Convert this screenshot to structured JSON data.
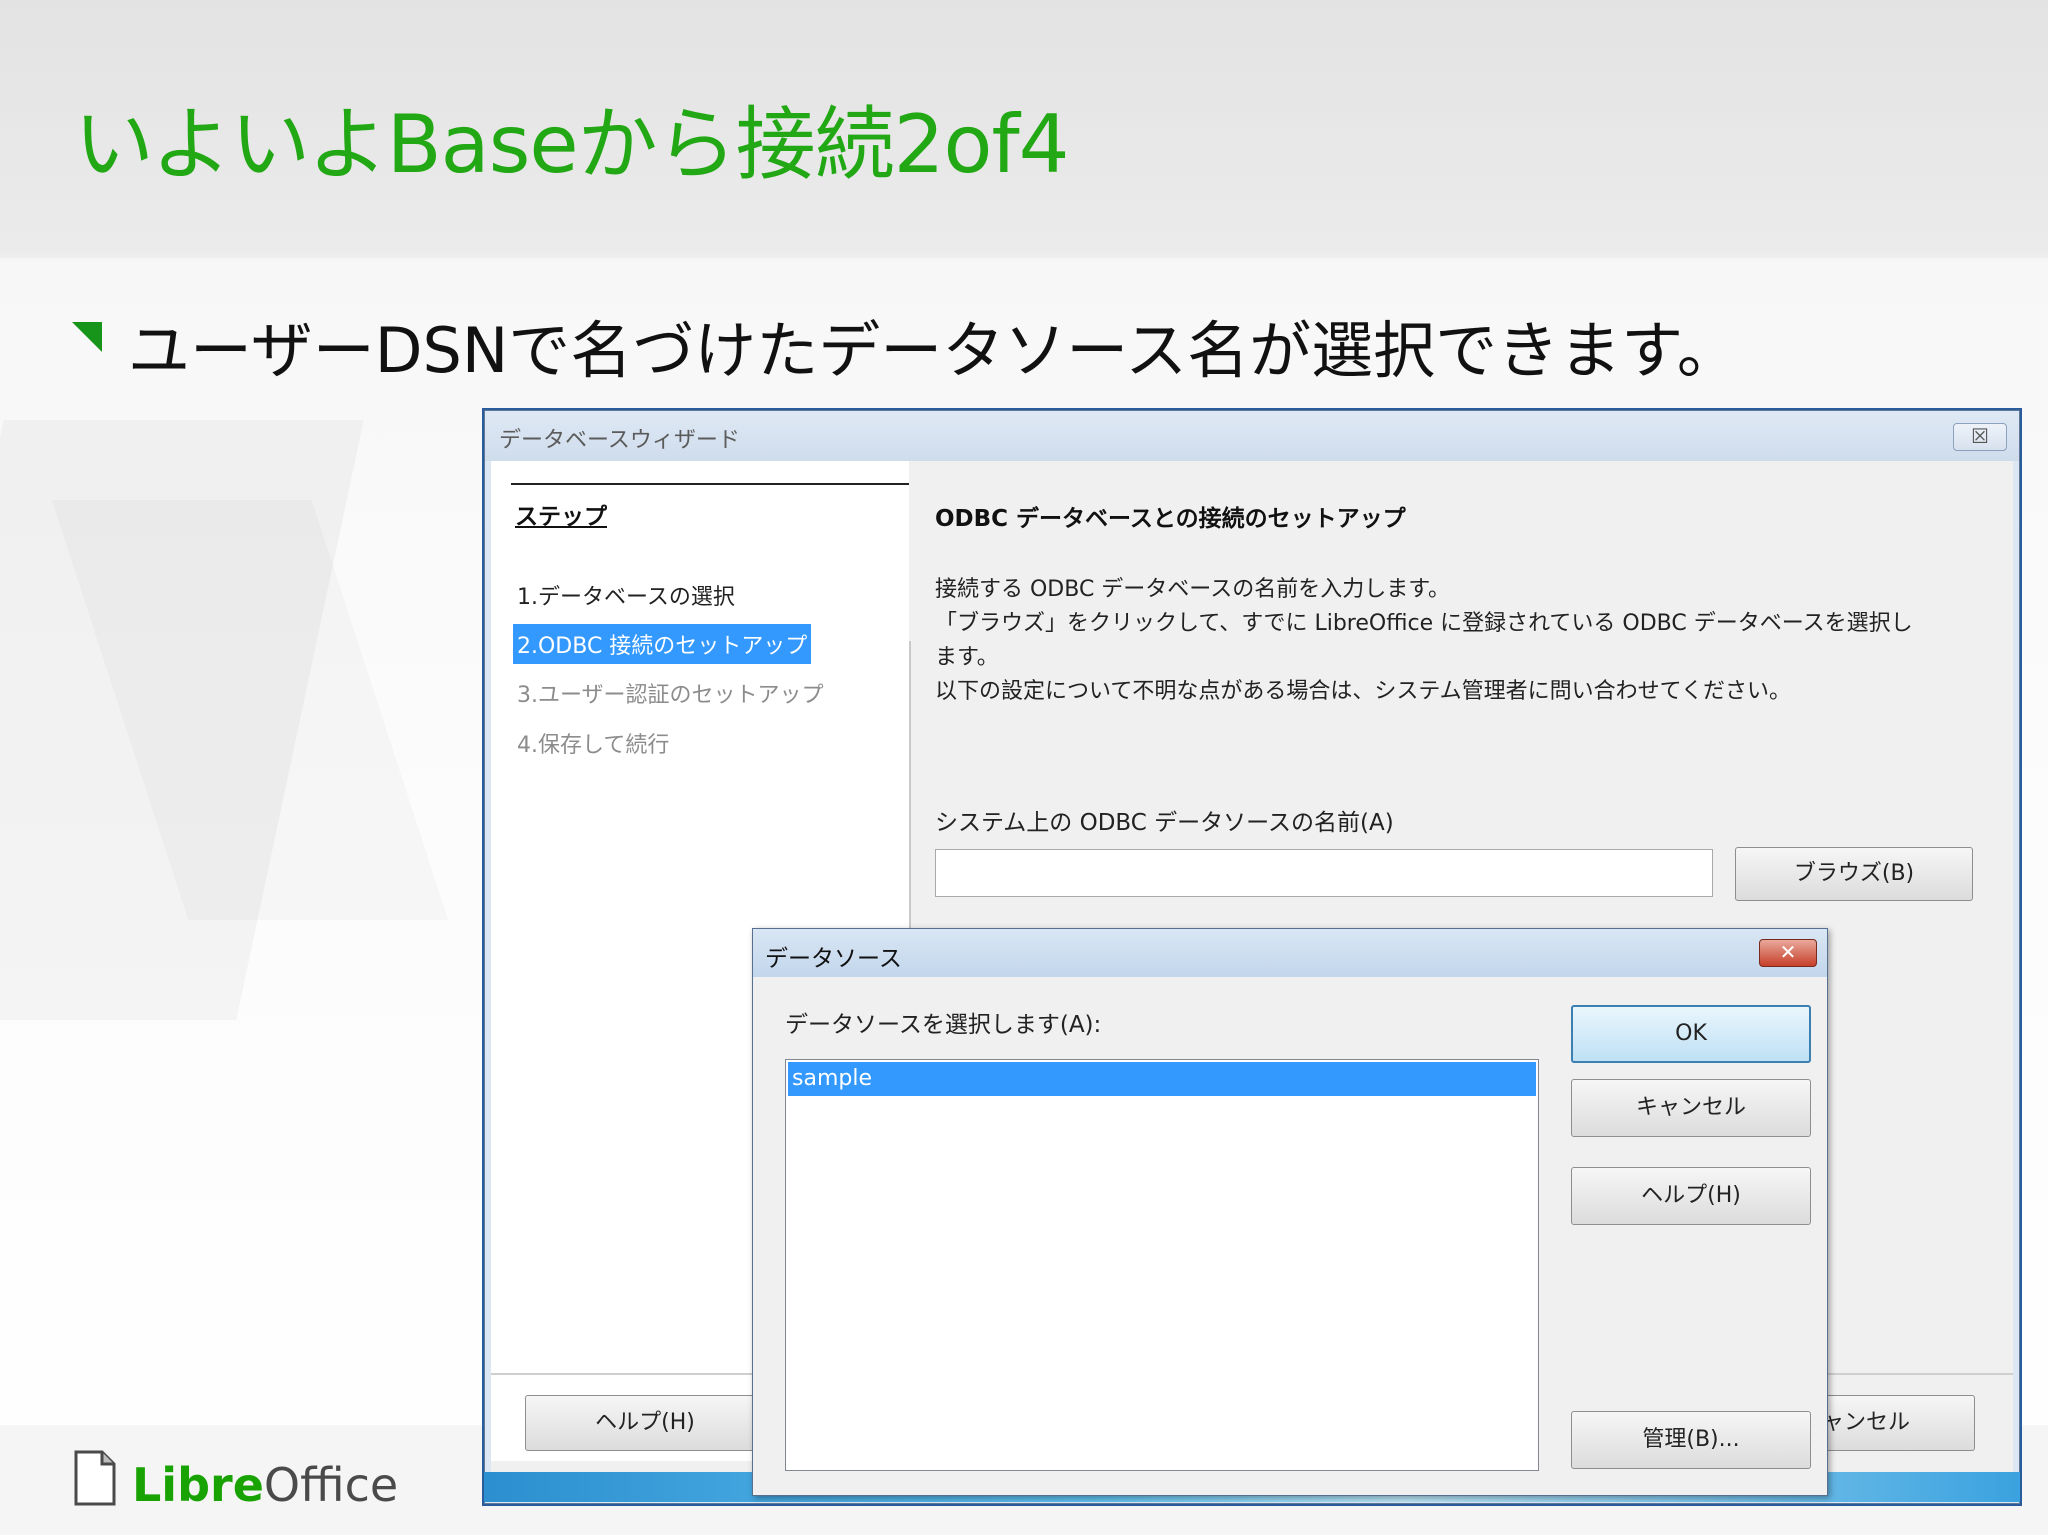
{
  "slide": {
    "title": "いよいよBaseから接続2of4",
    "bullet": "ユーザーDSNで名づけたデータソース名が選択できます。",
    "logo": {
      "libre": "Libre",
      "office": "Office"
    }
  },
  "wizard": {
    "title": "データベースウィザード",
    "close_label": "☒",
    "steps_heading": "ステップ",
    "steps": [
      "1.データベースの選択",
      "2.ODBC 接続のセットアップ",
      "3.ユーザー認証のセットアップ",
      "4.保存して続行"
    ],
    "page_heading": "ODBC データベースとの接続のセットアップ",
    "description_lines": [
      "接続する ODBC データベースの名前を入力します。",
      "「ブラウズ」をクリックして、すでに LibreOffice に登録されている ODBC データベースを選択し",
      "ます。",
      "以下の設定について不明な点がある場合は、システム管理者に問い合わせてください。"
    ],
    "field_label": "システム上の ODBC データソースの名前(A)",
    "field_value": "",
    "browse_button": "ブラウズ(B)",
    "help_button": "ヘルプ(H)",
    "cancel_button": "キャンセル"
  },
  "datasource_dialog": {
    "title": "データソース",
    "close_label": "✕",
    "label": "データソースを選択します(A):",
    "items": [
      "sample"
    ],
    "selected_index": 0,
    "buttons": {
      "ok": "OK",
      "cancel": "キャンセル",
      "help": "ヘルプ(H)",
      "manage": "管理(B)..."
    }
  },
  "colors": {
    "title_green": "#22a814",
    "selection_blue": "#3399ff",
    "logo_green": "#18a303"
  }
}
